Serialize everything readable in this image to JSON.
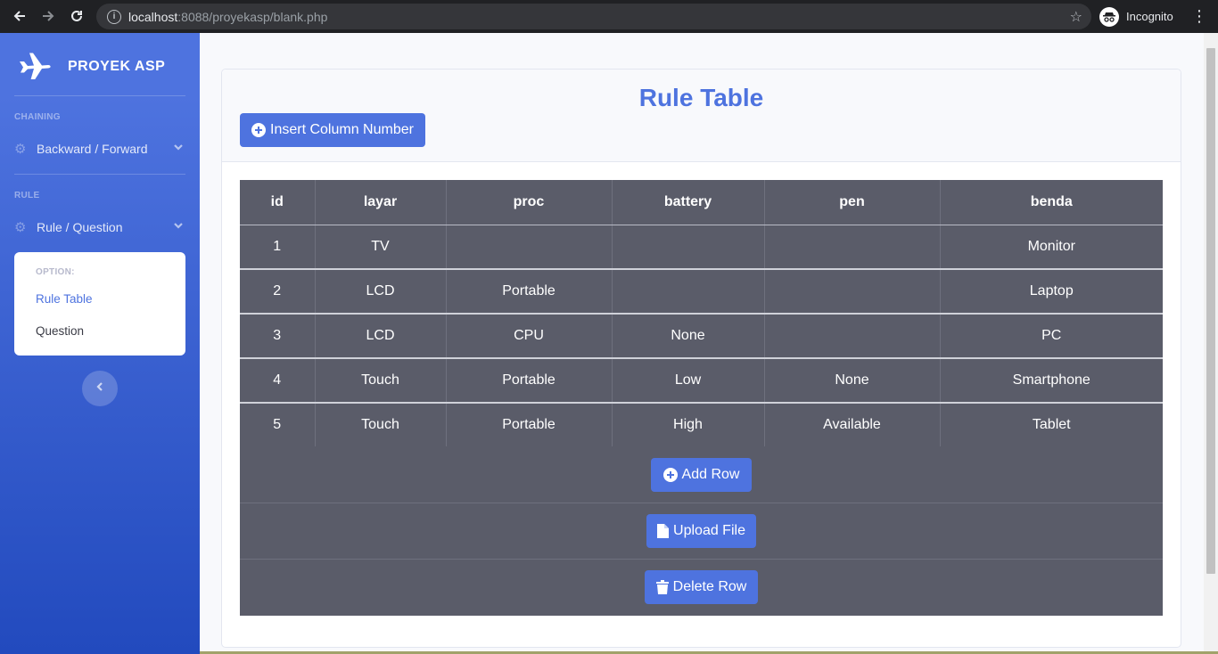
{
  "browser": {
    "url_host": "localhost",
    "url_rest": ":8088/proyekasp/blank.php",
    "profile_label": "Incognito"
  },
  "sidebar": {
    "brand": "PROYEK ASP",
    "heading_chaining": "CHAINING",
    "item_backward_forward": "Backward / Forward",
    "heading_rule": "RULE",
    "item_rule_question": "Rule / Question",
    "collapse": {
      "header": "OPTION:",
      "items": [
        "Rule Table",
        "Question"
      ]
    }
  },
  "main": {
    "title": "Rule Table",
    "insert_button": "Insert Column Number",
    "table": {
      "headers": [
        "id",
        "layar",
        "proc",
        "battery",
        "pen",
        "benda"
      ],
      "rows": [
        [
          "1",
          "TV",
          "",
          "",
          "",
          "Monitor"
        ],
        [
          "2",
          "LCD",
          "Portable",
          "",
          "",
          "Laptop"
        ],
        [
          "3",
          "LCD",
          "CPU",
          "None",
          "",
          "PC"
        ],
        [
          "4",
          "Touch",
          "Portable",
          "Low",
          "None",
          "Smartphone"
        ],
        [
          "5",
          "Touch",
          "Portable",
          "High",
          "Available",
          "Tablet"
        ]
      ]
    },
    "add_row_button": "Add Row",
    "upload_button": "Upload File",
    "delete_button": "Delete Row"
  },
  "colors": {
    "primary": "#4e73df",
    "table_bg": "#5a5c69"
  }
}
